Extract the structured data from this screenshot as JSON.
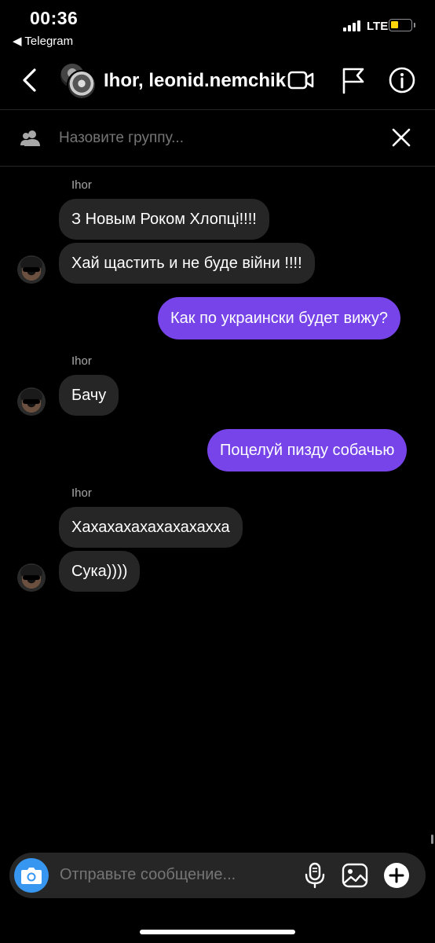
{
  "status_bar": {
    "time": "00:36",
    "back_app": "◀ Telegram",
    "network": "LTE",
    "signal_bars": 4,
    "battery_level": 0.3,
    "battery_color": "#ffd60a"
  },
  "header": {
    "title": "Ihor, leonid.nemchik",
    "back_icon": "chevron-left-icon",
    "video_icon": "video-camera-icon",
    "flag_icon": "flag-icon",
    "info_icon": "info-icon"
  },
  "group_name": {
    "placeholder": "Назовите группу..."
  },
  "messages": [
    {
      "type": "sender",
      "text": "Ihor"
    },
    {
      "type": "in",
      "text": "З Новым Роком Хлопці!!!!"
    },
    {
      "type": "in",
      "text": "Хай щастить и не буде війни !!!!"
    },
    {
      "type": "out",
      "text": "Как по украински будет вижу?"
    },
    {
      "type": "sender",
      "text": "Ihor"
    },
    {
      "type": "in",
      "text": "Бачу"
    },
    {
      "type": "out",
      "text": "Поцелуй пизду собачью"
    },
    {
      "type": "sender",
      "text": "Ihor"
    },
    {
      "type": "in",
      "text": "Хахахахахахахахахха"
    },
    {
      "type": "in",
      "text": "Сука))))"
    }
  ],
  "composer": {
    "placeholder": "Отправьте сообщение..."
  },
  "colors": {
    "accent": "#7644e8",
    "incoming_bubble": "#262626",
    "camera_button": "#3797f0"
  }
}
